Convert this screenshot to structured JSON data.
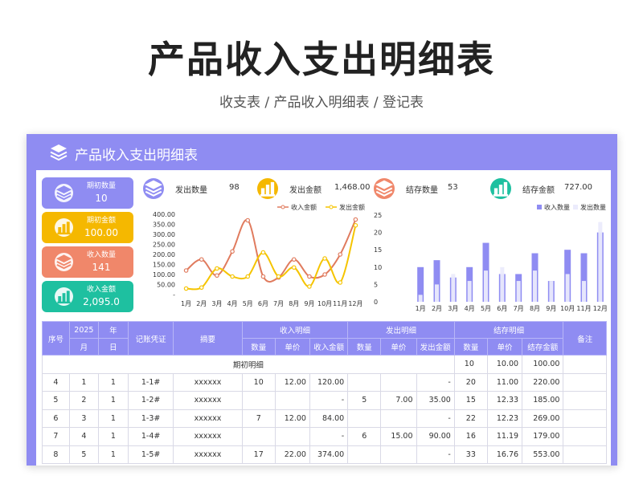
{
  "page": {
    "title": "产品收入支出明细表",
    "subtitle": "收支表 / 产品收入明细表 / 登记表"
  },
  "sheet": {
    "title": "产品收入支出明细表"
  },
  "cards": [
    {
      "label": "期初数量",
      "value": "10",
      "color": "#8f8cf2",
      "icon": "layers-icon"
    },
    {
      "label": "期初金额",
      "value": "100.00",
      "color": "#f5b800",
      "icon": "bar-chart-icon"
    },
    {
      "label": "收入数量",
      "value": "141",
      "color": "#f0876a",
      "icon": "layers-icon"
    },
    {
      "label": "收入金额",
      "value": "2,095.0",
      "color": "#1ec0a0",
      "icon": "bar-chart-icon"
    }
  ],
  "summary": [
    {
      "label": "发出数量",
      "value": "98",
      "color": "#8f8cf2",
      "icon": "layers-icon"
    },
    {
      "label": "发出金额",
      "value": "1,468.00",
      "color": "#f5b800",
      "icon": "bar-chart-icon"
    },
    {
      "label": "结存数量",
      "value": "53",
      "color": "#f0876a",
      "icon": "layers-icon"
    },
    {
      "label": "结存金额",
      "value": "727.00",
      "color": "#1ec0a0",
      "icon": "bar-chart-icon"
    }
  ],
  "chart_data": [
    {
      "type": "line",
      "categories": [
        "1月",
        "2月",
        "3月",
        "4月",
        "5月",
        "6月",
        "7月",
        "8月",
        "9月",
        "10月",
        "11月",
        "12月"
      ],
      "ylim": [
        0,
        400
      ],
      "yticks": [
        "400.00",
        "350.00",
        "300.00",
        "250.00",
        "200.00",
        "150.00",
        "100.00",
        "50.00",
        "-"
      ],
      "series": [
        {
          "name": "收入金额",
          "color": "#e07b5e",
          "values": [
            120,
            175,
            95,
            215,
            370,
            90,
            85,
            175,
            90,
            100,
            200,
            374
          ]
        },
        {
          "name": "发出金额",
          "color": "#f5c400",
          "values": [
            30,
            35,
            130,
            90,
            90,
            210,
            90,
            135,
            40,
            180,
            60,
            345
          ]
        }
      ],
      "legend": "top-right"
    },
    {
      "type": "bar",
      "categories": [
        "1月",
        "2月",
        "3月",
        "4月",
        "5月",
        "6月",
        "7月",
        "8月",
        "9月",
        "10月",
        "11月",
        "12月"
      ],
      "ylim": [
        0,
        25
      ],
      "yticks": [
        "25",
        "20",
        "15",
        "10",
        "5",
        "0"
      ],
      "series": [
        {
          "name": "收入数量",
          "color": "#8f8cf2",
          "values": [
            10,
            12,
            7,
            10,
            17,
            8,
            8,
            14,
            6,
            15,
            14,
            20
          ]
        },
        {
          "name": "发出数量",
          "color": "#ebebfc",
          "values": [
            2,
            5,
            8,
            6,
            9,
            10,
            6,
            9,
            6,
            8,
            6,
            23
          ]
        }
      ],
      "legend": "top-right"
    }
  ],
  "table": {
    "h": {
      "seq": "序号",
      "year": "2025",
      "year_unit": "年",
      "month": "月",
      "day": "日",
      "voucher": "记账凭证",
      "summary": "摘要",
      "income": "收入明细",
      "issue": "发出明细",
      "balance": "结存明细",
      "remark": "备注",
      "qty": "数量",
      "price": "单价",
      "income_amt": "收入金额",
      "issue_amt": "发出金额",
      "balance_amt": "结存金额"
    },
    "opening": {
      "label": "期初明细",
      "qty": "10",
      "price": "10.00",
      "amt": "100.00"
    },
    "rows": [
      {
        "seq": "4",
        "m": "1",
        "d": "1",
        "voucher": "1-1#",
        "summary": "xxxxxx",
        "iq": "10",
        "ip": "12.00",
        "ia": "120.00",
        "oq": "",
        "op": "",
        "oa": "-",
        "bq": "20",
        "bp": "11.00",
        "ba": "220.00",
        "remark": ""
      },
      {
        "seq": "5",
        "m": "2",
        "d": "1",
        "voucher": "1-2#",
        "summary": "xxxxxx",
        "iq": "",
        "ip": "",
        "ia": "-",
        "oq": "5",
        "op": "7.00",
        "oa": "35.00",
        "bq": "15",
        "bp": "12.33",
        "ba": "185.00",
        "remark": ""
      },
      {
        "seq": "6",
        "m": "3",
        "d": "1",
        "voucher": "1-3#",
        "summary": "xxxxxx",
        "iq": "7",
        "ip": "12.00",
        "ia": "84.00",
        "oq": "",
        "op": "",
        "oa": "-",
        "bq": "22",
        "bp": "12.23",
        "ba": "269.00",
        "remark": ""
      },
      {
        "seq": "7",
        "m": "4",
        "d": "1",
        "voucher": "1-4#",
        "summary": "xxxxxx",
        "iq": "",
        "ip": "",
        "ia": "-",
        "oq": "6",
        "op": "15.00",
        "oa": "90.00",
        "bq": "16",
        "bp": "11.19",
        "ba": "179.00",
        "remark": ""
      },
      {
        "seq": "8",
        "m": "5",
        "d": "1",
        "voucher": "1-5#",
        "summary": "xxxxxx",
        "iq": "17",
        "ip": "22.00",
        "ia": "374.00",
        "oq": "",
        "op": "",
        "oa": "-",
        "bq": "33",
        "bp": "16.76",
        "ba": "553.00",
        "remark": ""
      }
    ]
  }
}
